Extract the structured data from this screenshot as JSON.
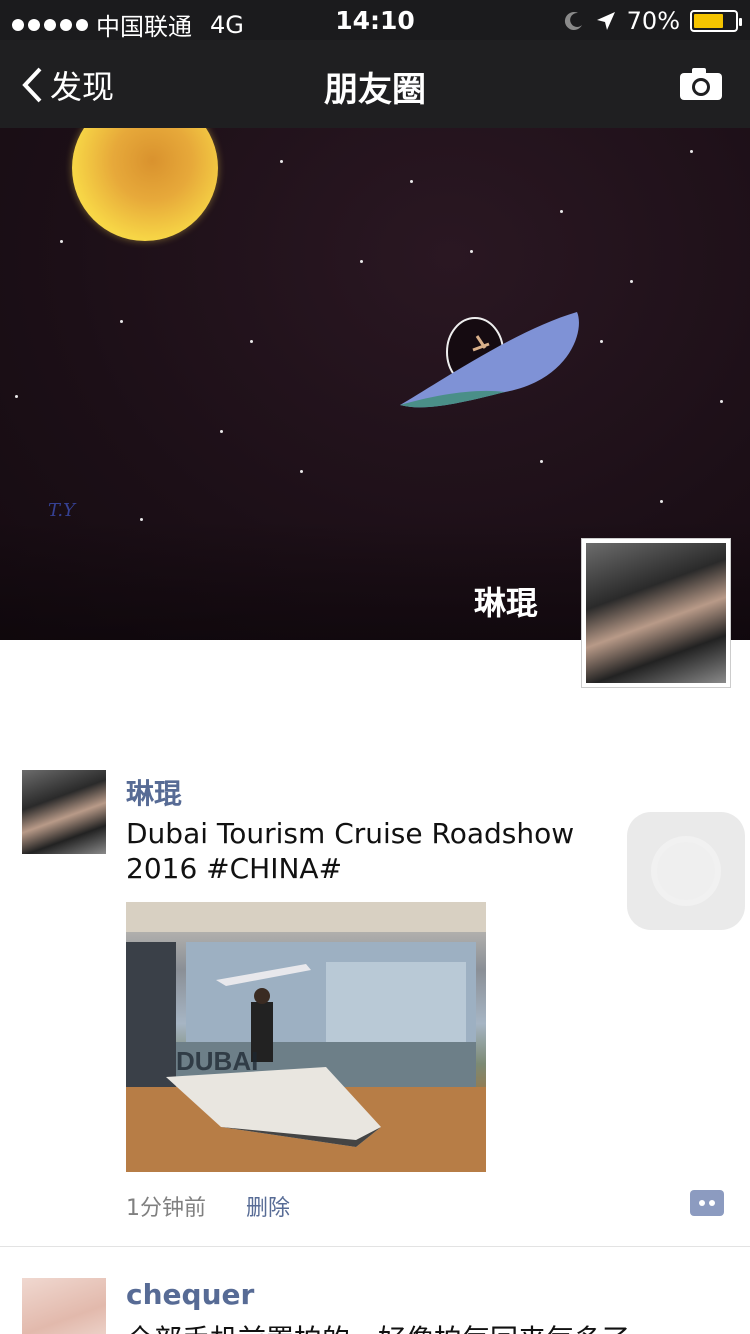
{
  "status_bar": {
    "carrier": "中国联通",
    "network": "4G",
    "time": "14:10",
    "battery_percent": "70%",
    "battery_level": 0.7,
    "battery_color": "#f5c400"
  },
  "nav": {
    "back_label": "发现",
    "title": "朋友圈",
    "camera_icon": "camera-icon"
  },
  "cover": {
    "user_name": "琳琨"
  },
  "posts": [
    {
      "author": "琳琨",
      "text": "Dubai Tourism Cruise Roadshow 2016 #CHINA#",
      "photo_sign": "DUBAI",
      "time": "1分钟前",
      "delete_label": "删除"
    },
    {
      "author": "chequer",
      "text": "全部手机前置拍的，好像拍每回来每多了"
    }
  ],
  "colors": {
    "link_blue": "#576b95"
  }
}
